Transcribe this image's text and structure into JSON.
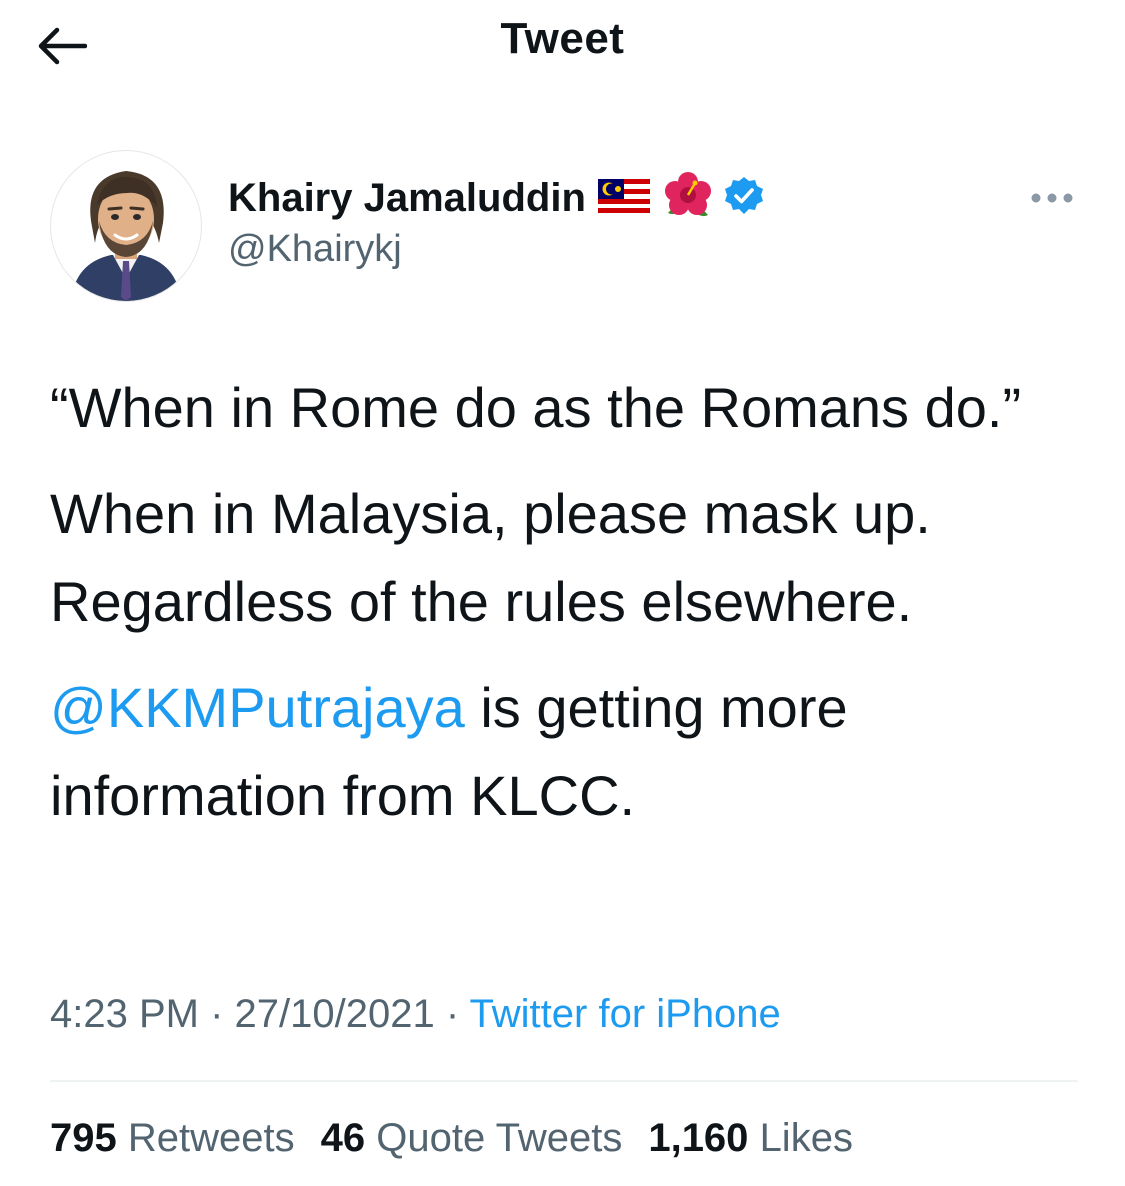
{
  "header": {
    "title": "Tweet",
    "back_icon": "arrow-left-icon"
  },
  "author": {
    "display_name": "Khairy Jamaluddin",
    "handle": "@Khairykj",
    "name_emojis": [
      "malaysia-flag-icon",
      "hibiscus-icon"
    ],
    "verified_icon": "verified-badge-icon",
    "avatar_icon": "cartoon-avatar-icon"
  },
  "more_icon": "more-horizontal-icon",
  "tweet": {
    "paragraph_1": "“When in Rome do as the Romans do.”",
    "paragraph_2_line_1": "When in Malaysia, please mask up.",
    "paragraph_2_line_2": "Regardless of the rules elsewhere.",
    "mention": "@KKMPutrajaya",
    "paragraph_3_rest": " is getting more information from KLCC."
  },
  "meta": {
    "time": "4:23 PM",
    "separator": " · ",
    "date": "27/10/2021",
    "source": "Twitter for iPhone"
  },
  "stats": [
    {
      "count": "795",
      "label": "Retweets"
    },
    {
      "count": "46",
      "label": "Quote Tweets"
    },
    {
      "count": "1,160",
      "label": "Likes"
    }
  ],
  "colors": {
    "accent": "#1d9bf0",
    "text": "#0f1419",
    "secondary": "#536471",
    "divider": "#eff3f4"
  }
}
